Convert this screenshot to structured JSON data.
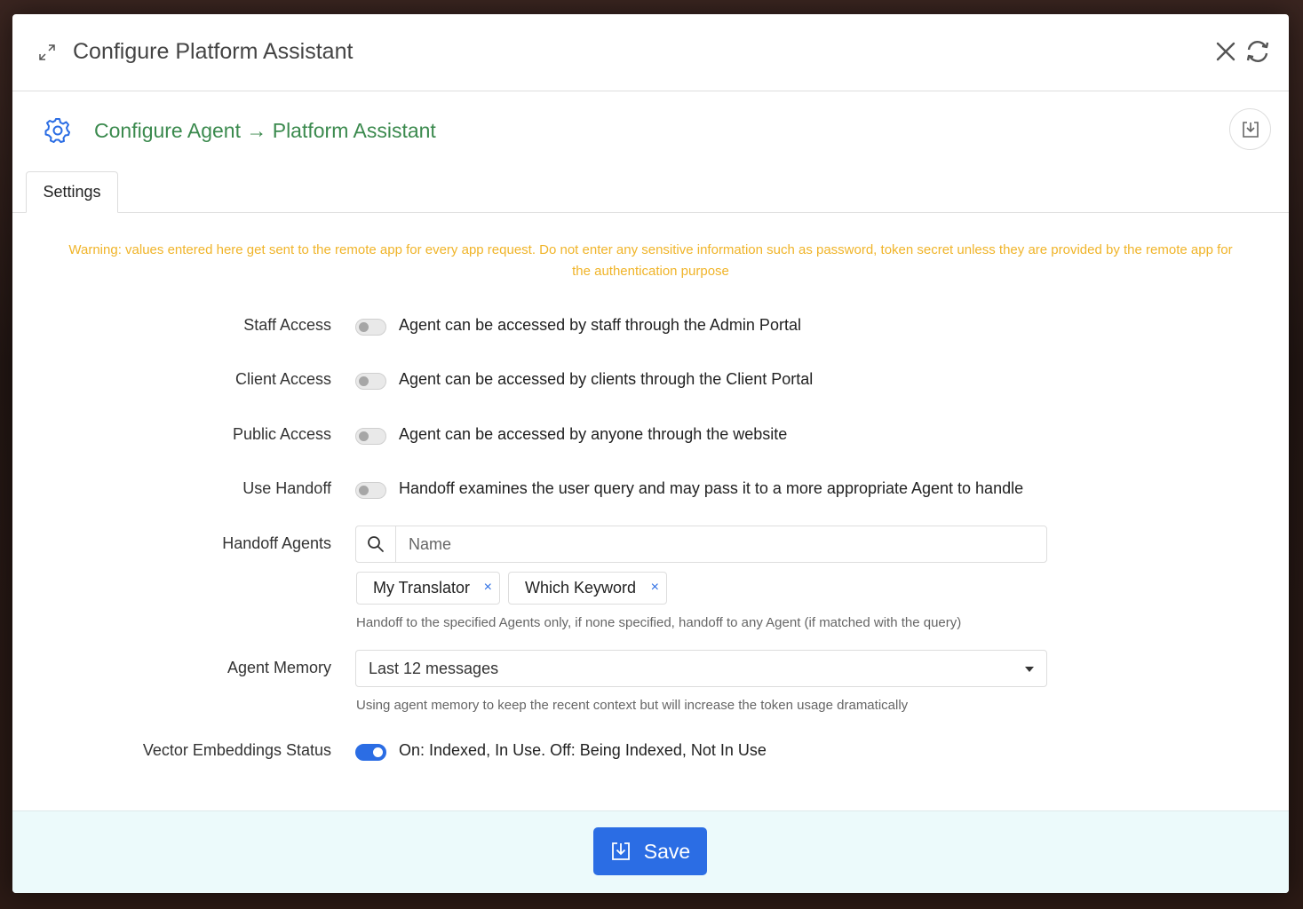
{
  "modal": {
    "title": "Configure Platform Assistant"
  },
  "sub_header": {
    "breadcrumb": "Configure Agent → Platform Assistant"
  },
  "tabs": [
    {
      "label": "Settings",
      "active": true
    }
  ],
  "warning": "Warning: values entered here get sent to the remote app for every app request. Do not enter any sensitive information such as password, token secret unless they are provided by the remote app for the authentication purpose",
  "settings": {
    "staff_access": {
      "label": "Staff Access",
      "description": "Agent can be accessed by staff through the Admin Portal",
      "enabled": false
    },
    "client_access": {
      "label": "Client Access",
      "description": "Agent can be accessed by clients through the Client Portal",
      "enabled": false
    },
    "public_access": {
      "label": "Public Access",
      "description": "Agent can be accessed by anyone through the website",
      "enabled": false
    },
    "use_handoff": {
      "label": "Use Handoff",
      "description": "Handoff examines the user query and may pass it to a more appropriate Agent to handle",
      "enabled": false
    },
    "handoff_agents": {
      "label": "Handoff Agents",
      "placeholder": "Name",
      "value": "",
      "chips": [
        "My Translator",
        "Which Keyword"
      ],
      "chip_remove": "×",
      "help": "Handoff to the specified Agents only, if none specified, handoff to any Agent (if matched with the query)"
    },
    "agent_memory": {
      "label": "Agent Memory",
      "selected": "Last 12 messages",
      "help": "Using agent memory to keep the recent context but will increase the token usage dramatically"
    },
    "vector_embeddings": {
      "label": "Vector Embeddings Status",
      "description": "On: Indexed, In Use. Off: Being Indexed, Not In Use",
      "enabled": true
    }
  },
  "footer": {
    "save_label": "Save"
  },
  "colors": {
    "accent": "#2b6de4",
    "breadcrumb": "#3b8a4e",
    "warning": "#f0b429",
    "footer_bg": "#ecfafb"
  },
  "icons": {
    "expand": "expand-icon",
    "close": "close-icon",
    "refresh": "refresh-icon",
    "gear": "gear-icon",
    "download": "download-icon",
    "search": "search-icon",
    "save": "save-icon"
  }
}
